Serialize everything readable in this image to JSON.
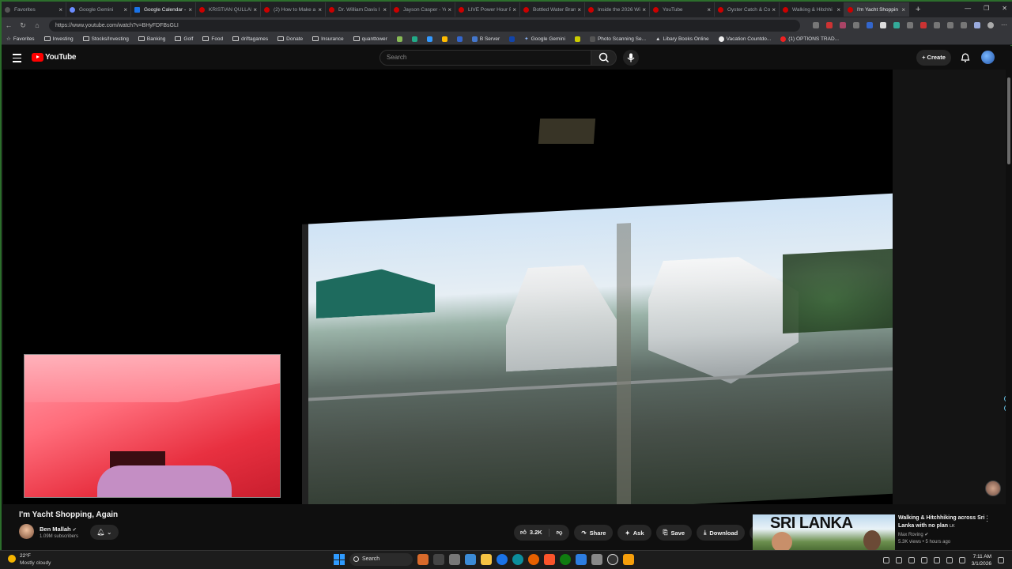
{
  "browser": {
    "tabs": [
      {
        "label": "Favorites",
        "icon": "star-icon",
        "active": false
      },
      {
        "label": "Google Gemini",
        "icon": "gemini-icon",
        "active": false
      },
      {
        "label": "Google Calendar - V",
        "icon": "calendar-icon",
        "active": false
      },
      {
        "label": "KRISTIAN QULLAM...",
        "icon": "youtube-icon",
        "active": false
      },
      {
        "label": "(2) How to Make a",
        "icon": "youtube-icon",
        "active": false
      },
      {
        "label": "Dr. William Davis l",
        "icon": "youtube-icon",
        "active": false
      },
      {
        "label": "Jayson Casper - Yo",
        "icon": "youtube-icon",
        "active": false
      },
      {
        "label": "LIVE Power Hour Pr",
        "icon": "youtube-icon",
        "active": false
      },
      {
        "label": "Bottled Water Bran",
        "icon": "youtube-icon",
        "active": false
      },
      {
        "label": "Inside the 2026 Wi",
        "icon": "youtube-icon",
        "active": false
      },
      {
        "label": "YouTube",
        "icon": "youtube-icon",
        "active": false
      },
      {
        "label": "Oyster Catch & Co",
        "icon": "youtube-icon",
        "active": false
      },
      {
        "label": "Walking & Hitchhi",
        "icon": "youtube-icon",
        "active": false
      },
      {
        "label": "I'm Yacht Shoppin",
        "icon": "youtube-icon",
        "active": true
      }
    ],
    "url": "https://www.youtube.com/watch?v=BHyFDFBsGLI",
    "bookmarks": [
      {
        "label": "Favorites",
        "icon": "star-icon"
      },
      {
        "label": "Investing",
        "icon": "folder-icon"
      },
      {
        "label": "Stocks/Investing",
        "icon": "folder-icon"
      },
      {
        "label": "Banking",
        "icon": "folder-icon"
      },
      {
        "label": "Golf",
        "icon": "folder-icon"
      },
      {
        "label": "Food",
        "icon": "folder-icon"
      },
      {
        "label": "driftagames",
        "icon": "folder-icon"
      },
      {
        "label": "Donate",
        "icon": "folder-icon"
      },
      {
        "label": "Insurance",
        "icon": "folder-icon"
      },
      {
        "label": "quanttower",
        "icon": "folder-icon"
      },
      {
        "label": "",
        "icon": "app-icon"
      },
      {
        "label": "",
        "icon": "app-icon"
      },
      {
        "label": "",
        "icon": "app-icon"
      },
      {
        "label": "",
        "icon": "app-icon"
      },
      {
        "label": "",
        "icon": "app-icon"
      },
      {
        "label": "B Server",
        "icon": "app-icon"
      },
      {
        "label": "",
        "icon": "app-icon"
      },
      {
        "label": "Google Gemini",
        "icon": "gemini-icon"
      },
      {
        "label": "",
        "icon": "app-icon"
      },
      {
        "label": "Photo Scanning Se...",
        "icon": "app-icon"
      },
      {
        "label": "Libary Books Online",
        "icon": "library-icon"
      },
      {
        "label": "Vacation Countdo...",
        "icon": "clock-icon"
      },
      {
        "label": "(1) OPTIONS TRAD...",
        "icon": "youtube-icon"
      }
    ]
  },
  "youtube": {
    "logo_text": "YouTube",
    "search_placeholder": "Search",
    "create_label": "Create"
  },
  "video": {
    "title": "I'm Yacht Shopping, Again",
    "channel": "Ben Mallah",
    "subscribers": "1.09M subscribers",
    "likes": "3.2K",
    "share_label": "Share",
    "ask_label": "Ask",
    "save_label": "Save",
    "download_label": "Download"
  },
  "recommendation": {
    "thumbnail_text": "SRI LANKA",
    "title": "Walking & Hitchhiking across Sri Lanka with no plan",
    "badge": "LK",
    "channel": "Max Roving",
    "meta": "5.3K views • 5 hours ago"
  },
  "taskbar": {
    "temperature": "22°F",
    "condition": "Mostly cloudy",
    "search_label": "Search",
    "time": "7:11 AM",
    "date": "3/1/2026"
  },
  "colors": {
    "brand_red": "#ff0000",
    "bg": "#0f0f0f",
    "pill": "#272727"
  }
}
